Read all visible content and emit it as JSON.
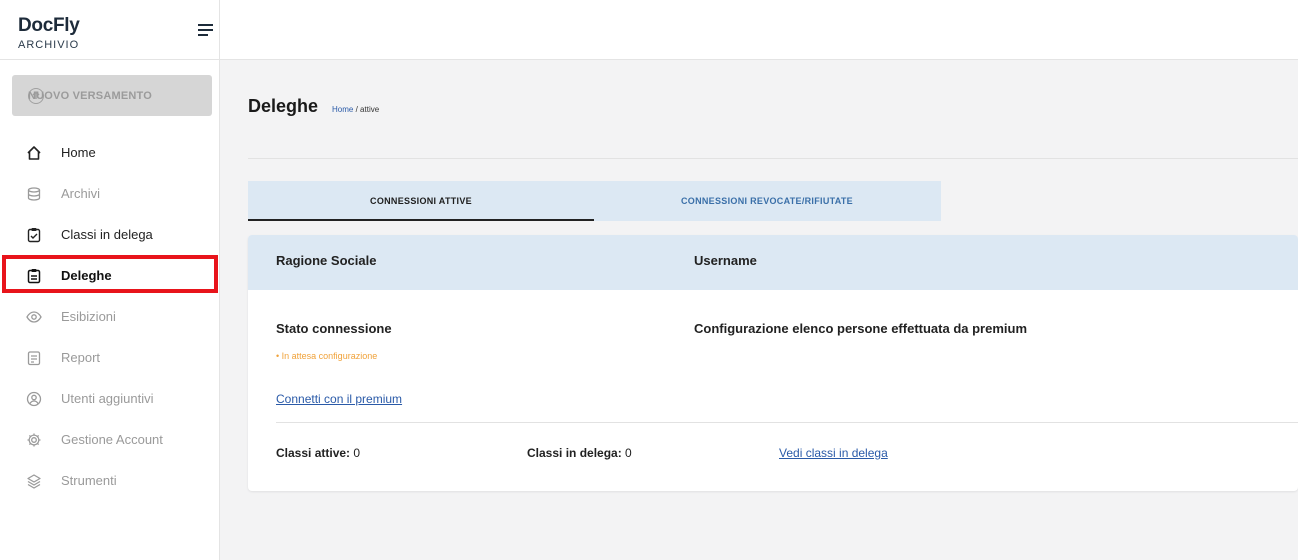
{
  "brand": {
    "title": "DocFly",
    "subtitle": "ARCHIVIO"
  },
  "sidebar": {
    "new_button": "NUOVO VERSAMENTO",
    "items": [
      {
        "label": "Home",
        "icon": "home-icon"
      },
      {
        "label": "Archivi",
        "icon": "database-icon"
      },
      {
        "label": "Classi in delega",
        "icon": "clipboard-check-icon"
      },
      {
        "label": "Deleghe",
        "icon": "document-icon"
      },
      {
        "label": "Esibizioni",
        "icon": "eye-icon"
      },
      {
        "label": "Report",
        "icon": "report-icon"
      },
      {
        "label": "Utenti aggiuntivi",
        "icon": "user-circle-icon"
      },
      {
        "label": "Gestione Account",
        "icon": "gear-icon"
      },
      {
        "label": "Strumenti",
        "icon": "layers-icon"
      }
    ]
  },
  "page": {
    "title": "Deleghe",
    "breadcrumb_home": "Home",
    "breadcrumb_current": "/ attive"
  },
  "tabs": {
    "active": "CONNESSIONI ATTIVE",
    "revoked": "CONNESSIONI REVOCATE/RIFIUTATE"
  },
  "card": {
    "col_ragione": "Ragione Sociale",
    "col_username": "Username",
    "stato_label": "Stato connessione",
    "stato_value": "• In attesa configurazione",
    "config_text": "Configurazione elenco persone effettuata da premium",
    "connect_link": "Connetti con il premium",
    "classi_attive_label": "Classi attive:",
    "classi_attive_value": "0",
    "classi_delega_label": "Classi in delega:",
    "classi_delega_value": "0",
    "vedi_link": "Vedi classi in delega"
  },
  "colors": {
    "highlight": "#e8141b",
    "accent_blue": "#2a5aa8",
    "pending_orange": "#f0a23a",
    "tab_bg": "#dce8f3"
  }
}
